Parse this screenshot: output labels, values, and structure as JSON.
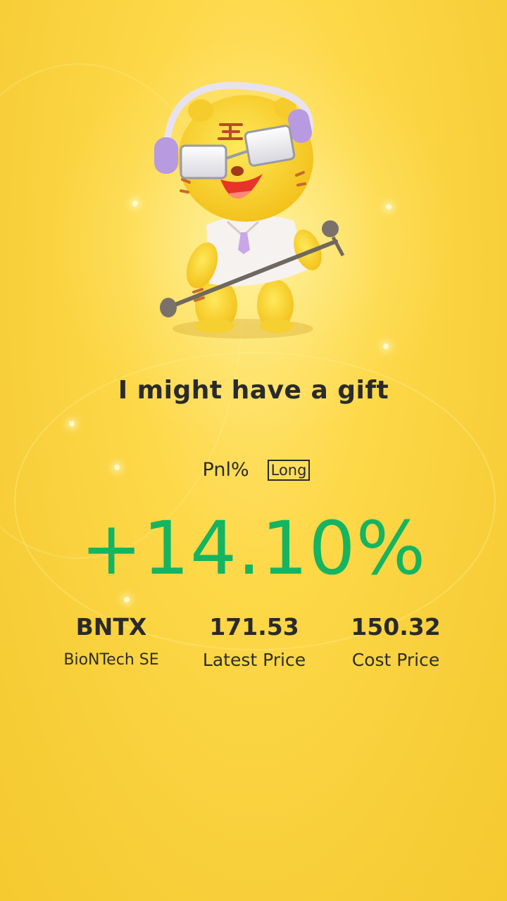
{
  "headline": "I might have a gift",
  "pnl": {
    "label": "Pnl%",
    "direction_badge": "Long",
    "value": "+14.10%",
    "value_color": "#15b461"
  },
  "stats": [
    {
      "value": "BNTX",
      "label": "BioNTech SE"
    },
    {
      "value": "171.53",
      "label": "Latest Price"
    },
    {
      "value": "150.32",
      "label": "Cost Price"
    }
  ],
  "mascot": {
    "icon": "tiger-mascot-singing-icon"
  },
  "colors": {
    "background": "#fdd848",
    "text": "#2a2a2a",
    "positive": "#15b461"
  }
}
